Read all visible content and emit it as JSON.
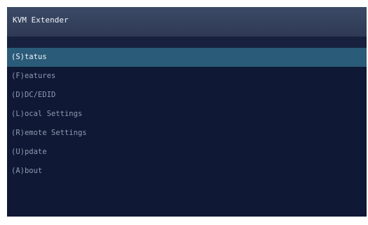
{
  "window": {
    "title": "KVM Extender"
  },
  "menu": {
    "selected_index": 0,
    "items": [
      {
        "label": "(S)tatus"
      },
      {
        "label": "(F)eatures"
      },
      {
        "label": "(D)DC/EDID"
      },
      {
        "label": "(L)ocal  Settings"
      },
      {
        "label": "(R)emote Settings"
      },
      {
        "label": "(U)pdate"
      },
      {
        "label": "(A)bout"
      }
    ]
  },
  "colors": {
    "background": "#0f1834",
    "title_bar": "#34415c",
    "selected_row": "#2a5b78",
    "text": "#8d9ab0",
    "selected_text": "#f2f6fb"
  }
}
